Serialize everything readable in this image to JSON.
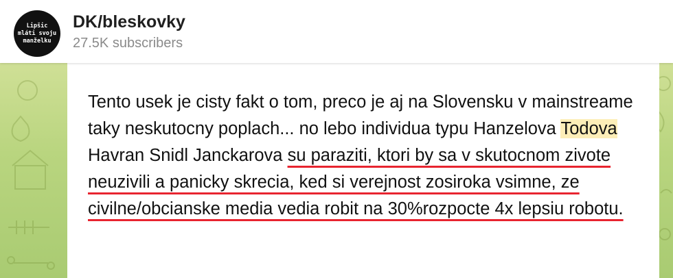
{
  "header": {
    "avatar_text": "Lipšic\nmláti svoju\nmanželku",
    "channel_name": "DK/bleskovky",
    "subscribers": "27.5K subscribers"
  },
  "message": {
    "segments": [
      {
        "text": "Tento usek je cisty fakt o tom, preco je aj na Slovensku v mainstreame taky neskutocny poplach... no lebo individua typu Hanzelova ",
        "style": "plain"
      },
      {
        "text": "Todova",
        "style": "highlight"
      },
      {
        "text": " Havran Snidl Janckarova ",
        "style": "plain"
      },
      {
        "text": "su paraziti, ktori by sa v skutocnom zivote neuzivili a panicky skrecia, ked si verejnost zosiroka vsimne, ze civilne/obcianske media vedia robit na 30%rozpocte 4x lepsiu robotu.",
        "style": "underline"
      }
    ]
  },
  "colors": {
    "highlight": "#fdeeb8",
    "underline": "#e8242f",
    "background_gradient_top": "#dfe7a6",
    "background_gradient_bottom": "#a9cb72"
  }
}
